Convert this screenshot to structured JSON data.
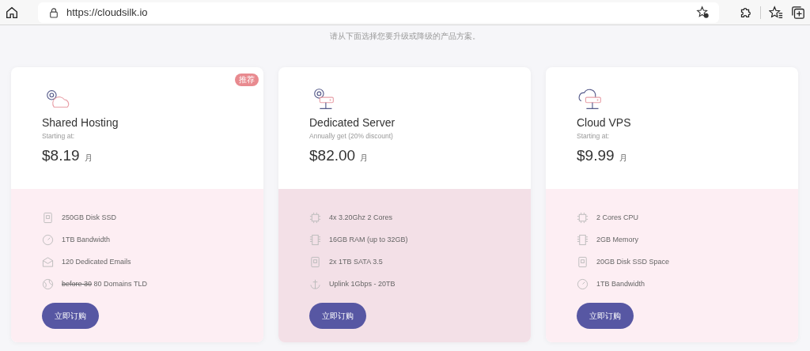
{
  "browser": {
    "url": "https://cloudsilk.io"
  },
  "subtitle": "请从下面选择您要升级或降级的产品方案。",
  "plans": [
    {
      "kind": "shared",
      "name": "Shared Hosting",
      "note": "Starting at:",
      "price": "$8.19",
      "period": "月",
      "badge": "推荐",
      "highlighted": false,
      "button": "立即订购",
      "features": [
        {
          "kind": "disk",
          "text": "250GB Disk SSD"
        },
        {
          "kind": "bandwidth",
          "text": "1TB Bandwidth"
        },
        {
          "kind": "email",
          "text": "120 Dedicated Emails"
        },
        {
          "kind": "domain",
          "struck": "before 30",
          "text": "80 Domains TLD"
        }
      ]
    },
    {
      "kind": "dedicated",
      "name": "Dedicated Server",
      "note": "Annually get (20% discount)",
      "price": "$82.00",
      "period": "月",
      "highlighted": true,
      "button": "立即订购",
      "features": [
        {
          "kind": "cpu",
          "text": "4x 3.20Ghz 2 Cores"
        },
        {
          "kind": "memory",
          "text": "16GB RAM (up to 32GB)"
        },
        {
          "kind": "disk",
          "text": "2x 1TB SATA 3.5"
        },
        {
          "kind": "uplink",
          "text": "Uplink 1Gbps - 20TB"
        }
      ]
    },
    {
      "kind": "vps",
      "name": "Cloud VPS",
      "note": "Starting at:",
      "price": "$9.99",
      "period": "月",
      "highlighted": false,
      "button": "立即订购",
      "features": [
        {
          "kind": "cpu",
          "text": "2 Cores CPU"
        },
        {
          "kind": "memory",
          "text": "2GB Memory"
        },
        {
          "kind": "disk",
          "text": "20GB Disk SSD Space"
        },
        {
          "kind": "bandwidth",
          "text": "1TB Bandwidth"
        }
      ]
    }
  ]
}
